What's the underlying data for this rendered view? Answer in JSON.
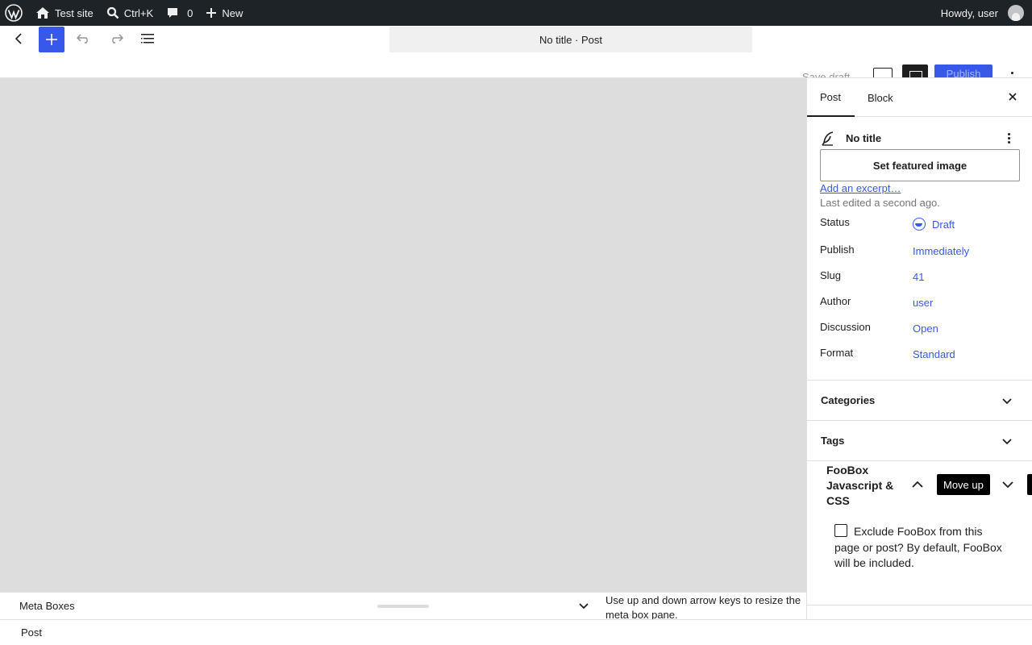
{
  "admin_bar": {
    "site_name": "Test site",
    "search_shortcut": "Ctrl+K",
    "comments_count": "0",
    "new_label": "New",
    "greeting": "Howdy, user"
  },
  "header": {
    "document_title": "No title · Post",
    "save_draft_label": "Save draft",
    "publish_label": "Publish"
  },
  "sidebar": {
    "tabs": [
      {
        "label": "Post"
      },
      {
        "label": "Block"
      }
    ],
    "post_title": "No title",
    "featured_image_label": "Set featured image",
    "add_excerpt_label": "Add an excerpt…",
    "last_edited": "Last edited a second ago.",
    "properties": [
      {
        "label": "Status",
        "value": "Draft"
      },
      {
        "label": "Publish",
        "value": "Immediately"
      },
      {
        "label": "Slug",
        "value": "41"
      },
      {
        "label": "Author",
        "value": "user"
      },
      {
        "label": "Discussion",
        "value": "Open"
      },
      {
        "label": "Format",
        "value": "Standard"
      }
    ],
    "panels": [
      {
        "title": "Categories"
      },
      {
        "title": "Tags"
      }
    ],
    "foobox": {
      "title": "FooBox Javascript & CSS",
      "move_up_tooltip": "Move up",
      "exclude_label": "Exclude FooBox from this page or post? By default, FooBox will be included.",
      "exclude_checked": false
    }
  },
  "meta_boxes": {
    "title": "Meta Boxes",
    "resize_hint": "Use up and down arrow keys to resize the meta box pane."
  },
  "footer": {
    "breadcrumb": "Post"
  },
  "colors": {
    "accent": "#3858e9",
    "admin_bar": "#1d2327",
    "canvas": "#dddddd"
  }
}
